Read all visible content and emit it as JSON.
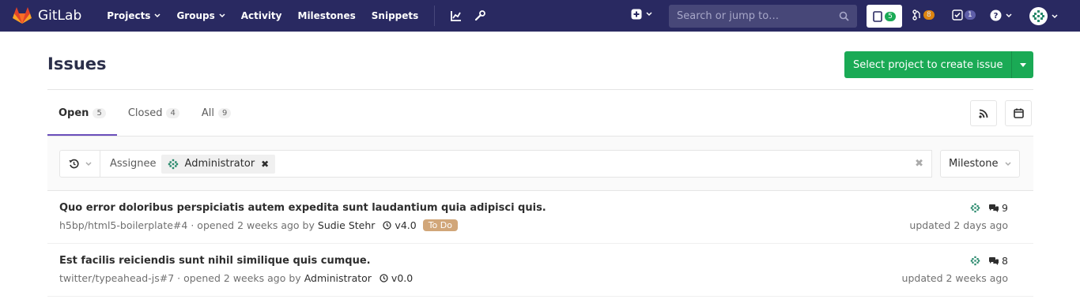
{
  "navbar": {
    "brand": "GitLab",
    "links": [
      {
        "label": "Projects",
        "dropdown": true
      },
      {
        "label": "Groups",
        "dropdown": true
      },
      {
        "label": "Activity",
        "dropdown": false
      },
      {
        "label": "Milestones",
        "dropdown": false
      },
      {
        "label": "Snippets",
        "dropdown": false
      }
    ],
    "search_placeholder": "Search or jump to…",
    "issues_count": "5",
    "mr_count": "8",
    "todos_count": "1",
    "bg_color": "#292961"
  },
  "header": {
    "title": "Issues",
    "create_button": "Select project to create issue"
  },
  "tabs": [
    {
      "label": "Open",
      "count": "5",
      "active": true
    },
    {
      "label": "Closed",
      "count": "4",
      "active": false
    },
    {
      "label": "All",
      "count": "9",
      "active": false
    }
  ],
  "filter": {
    "token_name": "Assignee",
    "token_value": "Administrator",
    "milestone_dropdown": "Milestone"
  },
  "issues": [
    {
      "title": "Quo error doloribus perspiciatis autem expedita sunt laudantium quia adipisci quis.",
      "ref": "h5bp/html5-boilerplate#4",
      "opened": "· opened 2 weeks ago by",
      "author": "Sudie Stehr",
      "milestone": "v4.0",
      "label": "To Do",
      "comments": "9",
      "updated": "updated 2 days ago"
    },
    {
      "title": "Est facilis reiciendis sunt nihil similique quis cumque.",
      "ref": "twitter/typeahead-js#7",
      "opened": "· opened 2 weeks ago by",
      "author": "Administrator",
      "milestone": "v0.0",
      "label": "",
      "comments": "8",
      "updated": "updated 2 weeks ago"
    }
  ],
  "colors": {
    "accent_green": "#1aaa55",
    "tab_underline": "#6b4fbb",
    "label_todo": "#d1a679"
  }
}
